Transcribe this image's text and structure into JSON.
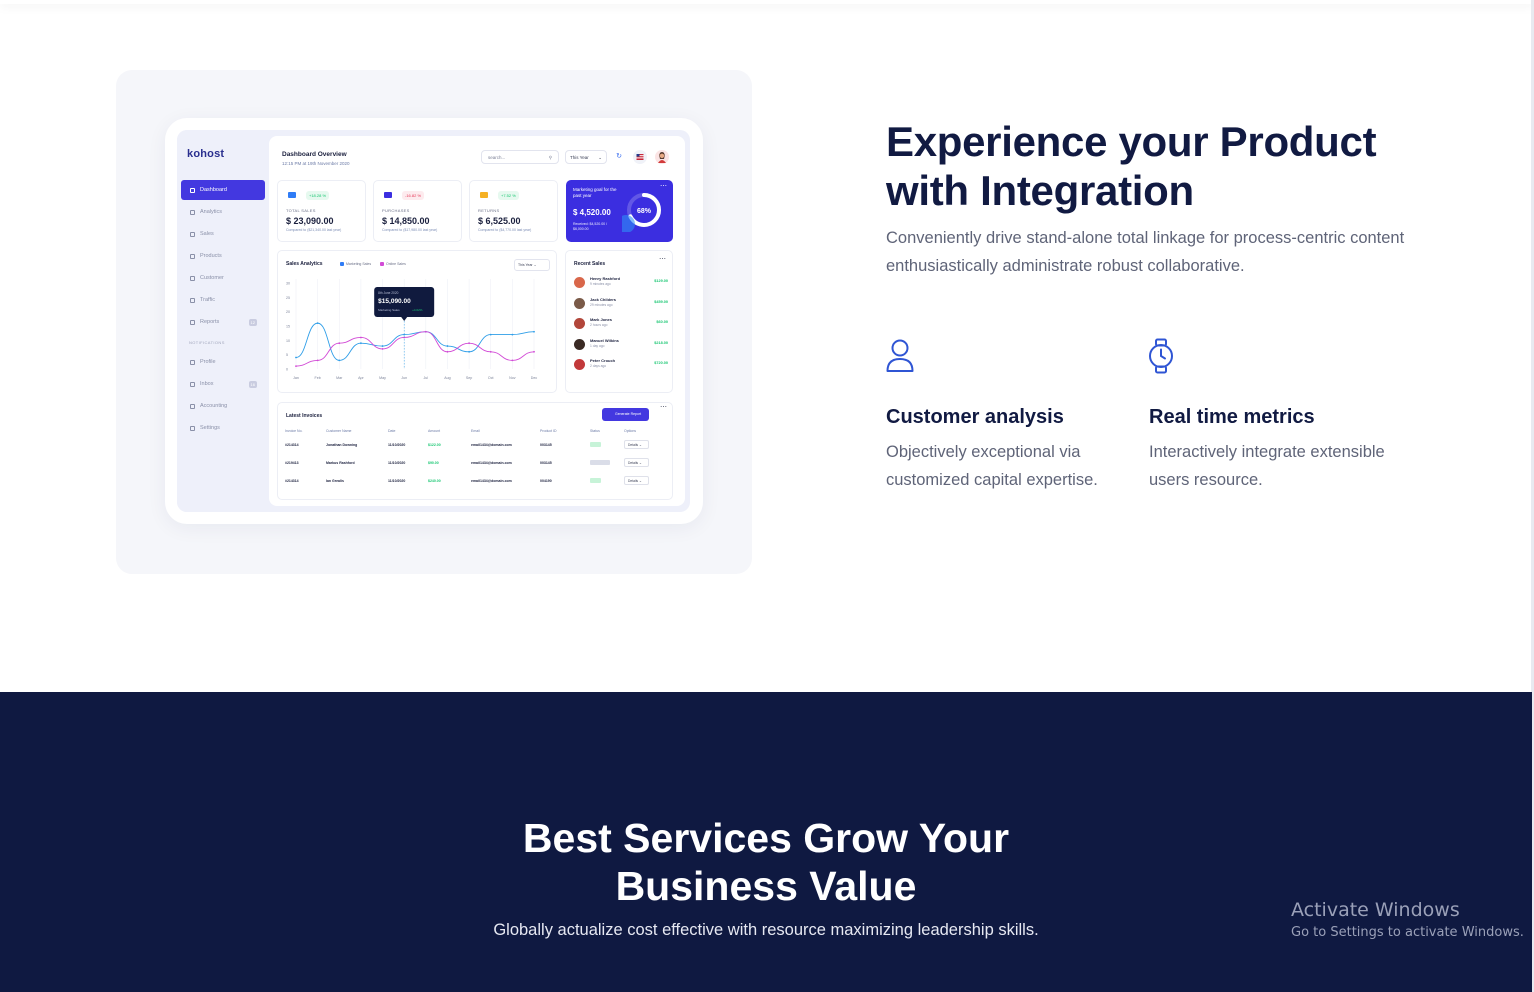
{
  "mockup": {
    "logo": "kohost",
    "nav": [
      {
        "label": "Dashboard"
      },
      {
        "label": "Analytics"
      },
      {
        "label": "Sales"
      },
      {
        "label": "Products"
      },
      {
        "label": "Customer"
      },
      {
        "label": "Traffic"
      },
      {
        "label": "Reports",
        "badge": "12"
      },
      {
        "label": "Profile"
      },
      {
        "label": "Inbox",
        "badge": "16"
      },
      {
        "label": "Accounting"
      },
      {
        "label": "Settings"
      }
    ],
    "nav_section_label": "NOTIFICATIONS",
    "title": "Dashboard Overview",
    "subtitle": "12:15 PM at 19th November 2020",
    "search_placeholder": "search...",
    "period_select": "This Year",
    "stats": [
      {
        "label": "TOTAL SALES",
        "value": "$ 23,090.00",
        "change": "+18.28 %",
        "compare": "Compared to ($21,340.00 last year)",
        "color": "#2f7cf6"
      },
      {
        "label": "PURCHASES",
        "value": "$ 14,850.00",
        "change": "-16.82 %",
        "compare": "Compared to ($17,980.00 last year)",
        "color": "#3b2ee0"
      },
      {
        "label": "RETURNS",
        "value": "$ 6,525.00",
        "change": "+7.52 %",
        "compare": "Compared to ($4,770.00 last year)",
        "color": "#f5b124"
      }
    ],
    "goal": {
      "title": "Marketing goal for the past year",
      "value": "$ 4,520.00",
      "sub": "Received: $4,520.00 / $6,000.00",
      "percent": "68%"
    },
    "analytics": {
      "title": "Sales Analytics",
      "legend": [
        "Marketing Sales",
        "Online Sales"
      ],
      "select": "This Year",
      "tooltip_date": "8th June 2020",
      "tooltip_value": "$15,090.00",
      "tooltip_label": "Marketing Sales",
      "tooltip_change": "+4.62%"
    },
    "chart_data": {
      "type": "line",
      "categories": [
        "Jan",
        "Feb",
        "Mar",
        "Apr",
        "May",
        "Jun",
        "Jul",
        "Aug",
        "Sep",
        "Oct",
        "Nov",
        "Dec"
      ],
      "y_ticks": [
        "0",
        "5",
        "10",
        "15",
        "20",
        "25",
        "30"
      ],
      "ylim": [
        0,
        30
      ],
      "series": [
        {
          "name": "Marketing Sales",
          "color": "#2f9ee8",
          "values": [
            4,
            16,
            3,
            9,
            8,
            12,
            13,
            8,
            6,
            12,
            12,
            13
          ]
        },
        {
          "name": "Online Sales",
          "color": "#d24bd6",
          "values": [
            1,
            3,
            9,
            11,
            7,
            11,
            13,
            6,
            9,
            6,
            3,
            6
          ]
        }
      ]
    },
    "recent": {
      "title": "Recent Sales",
      "items": [
        {
          "name": "Henry Rashford",
          "time": "9 minutes ago",
          "amount": "$129.00"
        },
        {
          "name": "Jack Childers",
          "time": "29 minutes ago",
          "amount": "$459.00"
        },
        {
          "name": "Mark Jones",
          "time": "2 hours ago",
          "amount": "$60.00"
        },
        {
          "name": "Manuel Wilkins",
          "time": "1 day ago",
          "amount": "$218.00"
        },
        {
          "name": "Peter Crouch",
          "time": "2 days ago",
          "amount": "$720.00"
        }
      ]
    },
    "invoices": {
      "title": "Latest Invoices",
      "button": "Generate Report",
      "headers": [
        "Invoice No.",
        "Customer Name",
        "Date",
        "Amount",
        "Email",
        "Product ID",
        "Status",
        "Options"
      ],
      "rows": [
        {
          "no": "#214314",
          "name": "Jonathan Downing",
          "date": "11/10/2020",
          "amount": "$122.00",
          "email": "email1434@domain.com",
          "pid": "003145",
          "status_color": "#c7f3d8",
          "option": "Details"
        },
        {
          "no": "#219413",
          "name": "Markus Rashford",
          "date": "11/10/2020",
          "amount": "$90.00",
          "email": "email1434@domain.com",
          "pid": "003145",
          "status_color": "#dadde8",
          "option": "Details"
        },
        {
          "no": "#214314",
          "name": "Ian Grealis",
          "date": "11/10/2020",
          "amount": "$240.00",
          "email": "email1434@domain.com",
          "pid": "004190",
          "status_color": "#c7f3d8",
          "option": "Details"
        }
      ]
    }
  },
  "copy": {
    "title": "Experience your Product with Integration",
    "lead": "Conveniently drive stand-alone total linkage for process-centric content enthusiastically administrate robust collaborative.",
    "features": [
      {
        "icon": "user-icon",
        "title": "Customer analysis",
        "desc": "Objectively exceptional via customized capital expertise."
      },
      {
        "icon": "watch-icon",
        "title": "Real time metrics",
        "desc": "Interactively integrate extensible users resource."
      }
    ]
  },
  "services": {
    "title": "Best Services Grow Your Business Value",
    "subtitle": "Globally actualize cost effective with resource maximizing leadership skills."
  },
  "watermark": {
    "line1": "Activate Windows",
    "line2": "Go to Settings to activate Windows."
  },
  "colors": {
    "navy": "#111a42",
    "dark_section": "#0f1941",
    "accent": "#4338e0",
    "green": "#17c671"
  }
}
